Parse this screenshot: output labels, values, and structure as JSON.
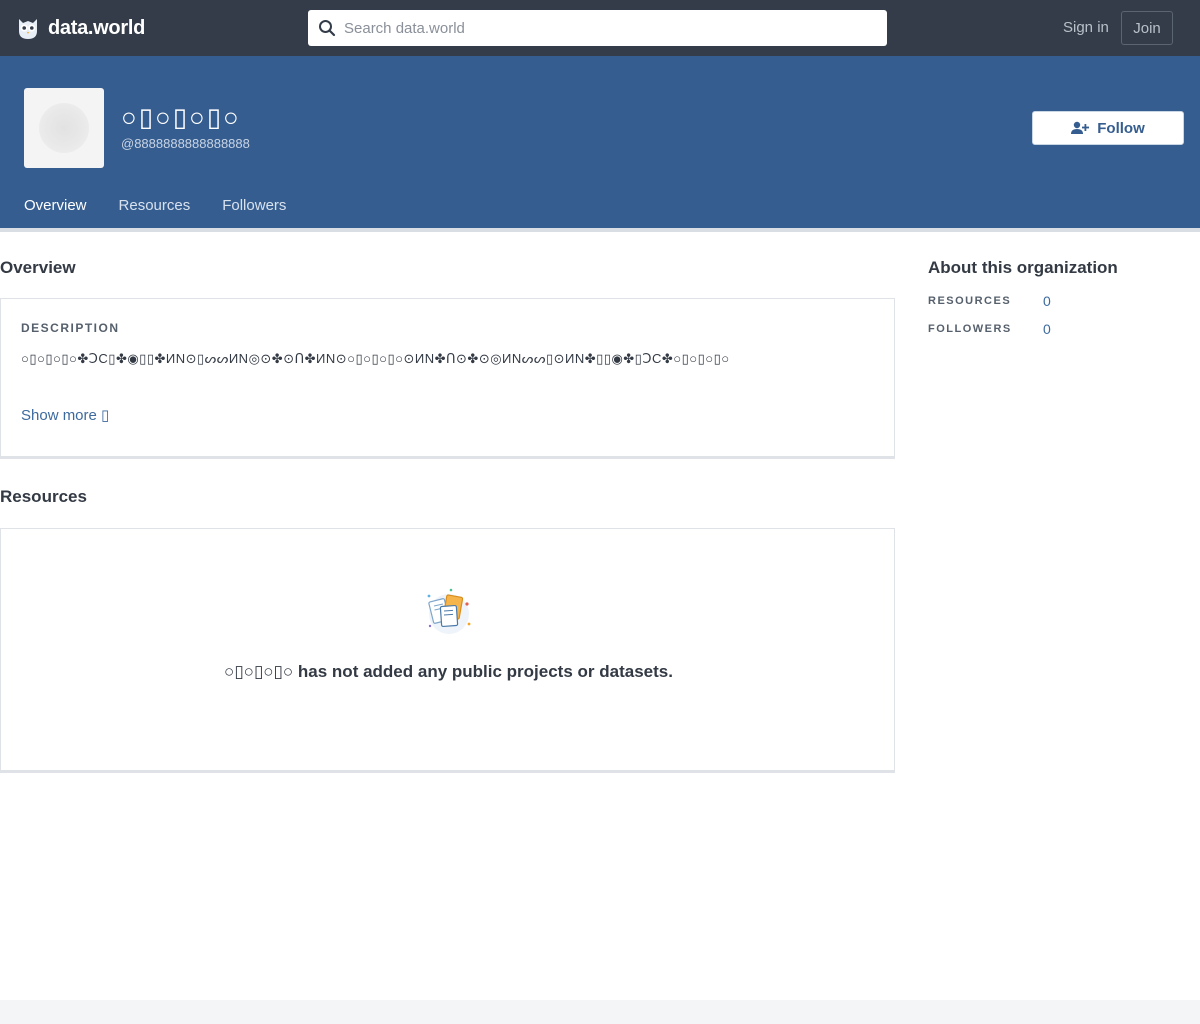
{
  "topbar": {
    "brand": "data.world",
    "search_placeholder": "Search data.world",
    "sign_in": "Sign in",
    "join": "Join"
  },
  "profile": {
    "name": "○▯○▯○▯○",
    "handle": "@8888888888888888",
    "follow_label": "Follow"
  },
  "tabs": [
    {
      "label": "Overview",
      "active": true
    },
    {
      "label": "Resources",
      "active": false
    },
    {
      "label": "Followers",
      "active": false
    }
  ],
  "overview": {
    "title": "Overview",
    "description_label": "DESCRIPTION",
    "description_text": "○▯○▯○▯○✤ↃC▯✤◉▯▯✤ИN⊙▯ᔕᔕИN◎⊙✤⊙Ո✤ИN⊙○▯○▯○▯○⊙ИN✤Ո⊙✤⊙◎ИNᔕᔕ▯⊙ИN✤▯▯◉✤▯ↃC✤○▯○▯○▯○",
    "show_more": "Show more ▯"
  },
  "resources": {
    "title": "Resources",
    "empty_name": "○▯○▯○▯○",
    "empty_message": " has not added any public projects or datasets."
  },
  "about": {
    "title": "About this organization",
    "stats": [
      {
        "label": "RESOURCES",
        "value": "0"
      },
      {
        "label": "FOLLOWERS",
        "value": "0"
      }
    ]
  },
  "colors": {
    "topbar": "#333c48",
    "header": "#355d8f",
    "accent": "#5fb3e4",
    "link": "#3d6a9e"
  },
  "icons": {
    "logo": "owl-logo-icon",
    "search": "search-icon",
    "follow": "add-user-icon",
    "empty": "empty-resources-illustration"
  }
}
